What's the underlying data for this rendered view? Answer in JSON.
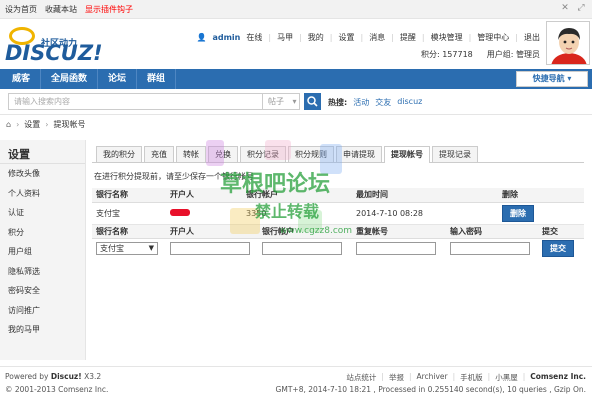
{
  "toolbar": {
    "set_home": "设为首页",
    "bookmark": "收藏本站",
    "show_hooks": "显示插件钩子"
  },
  "logo": {
    "brand": "DISCUZ!",
    "cn": "社区动力"
  },
  "user": {
    "name": "admin",
    "status": "在线",
    "menu": [
      "马甲",
      "我的",
      "设置",
      "消息",
      "提醒",
      "模块管理",
      "管理中心",
      "退出"
    ],
    "points_label": "积分: 157718",
    "group_label": "用户组: 管理员"
  },
  "nav": {
    "items": [
      "威客",
      "全局函数",
      "论坛",
      "群组"
    ],
    "quick": "快捷导航"
  },
  "search": {
    "placeholder": "请输入搜索内容",
    "type": "帖子",
    "hot_label": "热搜:",
    "hot_keywords": [
      "活动",
      "交友",
      "discuz"
    ]
  },
  "breadcrumb": {
    "settings": "设置",
    "page": "提现帐号"
  },
  "sidebar": {
    "title": "设置",
    "links": [
      "修改头像",
      "个人资料",
      "认证",
      "积分",
      "用户组",
      "隐私筛选",
      "密码安全",
      "访问推广",
      "我的马甲"
    ]
  },
  "tabs": [
    "我的积分",
    "充值",
    "转帐",
    "兑换",
    "积分记录",
    "积分规则",
    "申请提现",
    "提现帐号",
    "提现记录"
  ],
  "active_tab": "提现帐号",
  "note": "在进行积分提现前，请至少保存一个银行帐号",
  "accounts_table": {
    "headers": [
      "银行名称",
      "开户人",
      "银行帐户",
      "最加时间",
      "删除"
    ],
    "rows": [
      {
        "bank": "支付宝",
        "holder": "",
        "account": "3350",
        "time": "2014-7-10 08:28",
        "delete": "删除"
      }
    ]
  },
  "add_form": {
    "headers": [
      "银行名称",
      "开户人",
      "银行帐户",
      "重复帐号",
      "输入密码",
      "提交"
    ],
    "bank_selected": "支付宝",
    "submit": "提交"
  },
  "footer": {
    "powered": "Powered by",
    "product": "Discuz!",
    "version": "X3.2",
    "copyright": "© 2001-2013 Comsenz Inc.",
    "links": [
      "站点统计",
      "举报",
      "Archiver",
      "手机版",
      "小黑屋"
    ],
    "company": "Comsenz Inc.",
    "debug": "GMT+8, 2014-7-10 18:21 , Processed in 0.255140 second(s), 10 queries , Gzip On."
  },
  "watermark": {
    "line1": "草根吧论坛",
    "line2": "禁止转载",
    "line3": "www.cgzz8.com"
  },
  "colors": {
    "nav_blue": "#2b6db0",
    "logo_blue": "#1f5c9c",
    "red_link": "#ff0000",
    "watermark_green": "#28a03c"
  }
}
